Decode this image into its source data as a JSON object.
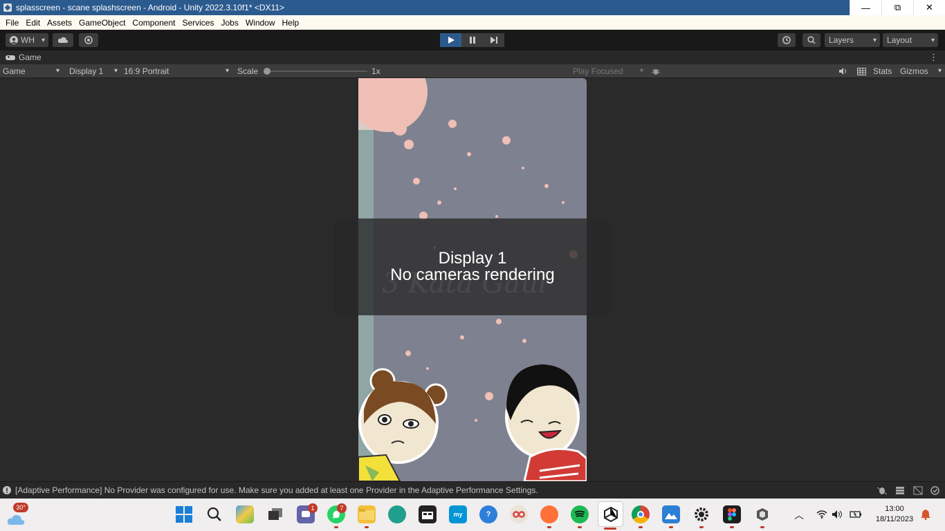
{
  "window": {
    "title": "splasscreen - scane splashscreen - Android - Unity 2022.3.10f1* <DX11>",
    "minimize": "—",
    "restore": "⧉",
    "close": "✕"
  },
  "menu": [
    "File",
    "Edit",
    "Assets",
    "GameObject",
    "Component",
    "Services",
    "Jobs",
    "Window",
    "Help"
  ],
  "toolbar": {
    "account": "WH",
    "layers": "Layers",
    "layout": "Layout"
  },
  "tab": {
    "title": "Game"
  },
  "gamebar": {
    "mode": "Game",
    "display": "Display 1",
    "aspect": "16:9 Portrait",
    "scale_label": "Scale",
    "scale_value": "1x",
    "play_focused": "Play Focused",
    "stats": "Stats",
    "gizmos": "Gizmos"
  },
  "overlay": {
    "line1": "Display 1",
    "line2": "No cameras rendering"
  },
  "console": {
    "message": "[Adaptive Performance] No Provider was configured for use. Make sure you added at least one Provider in the Adaptive Performance Settings."
  },
  "taskbar": {
    "weather_temp": "30°",
    "teams_badge": "1",
    "whatsapp_badge": "7",
    "time": "13:00",
    "date": "18/11/2023"
  }
}
